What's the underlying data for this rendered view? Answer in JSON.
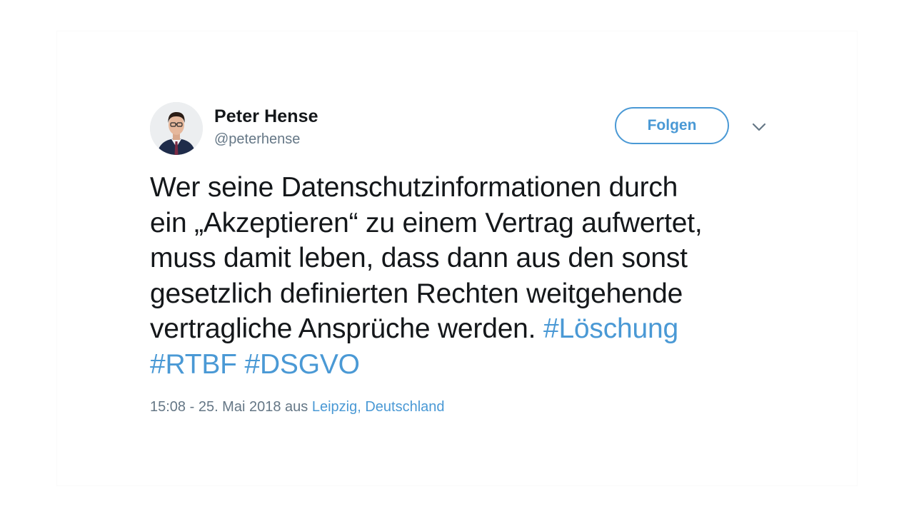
{
  "user": {
    "name": "Peter Hense",
    "handle": "@peterhense"
  },
  "follow_button": {
    "label": "Folgen"
  },
  "tweet": {
    "text_lines": [
      "Wer seine Datenschutzinformationen durch",
      "ein „Akzeptieren“ zu einem Vertrag aufwertet,",
      "muss damit leben, dass dann aus den sonst",
      "gesetzlich definierten Rechten weitgehende",
      "vertragliche Ansprüche werden."
    ],
    "hashtags": [
      "#Löschung",
      "#RTBF",
      "#DSGVO"
    ]
  },
  "meta": {
    "timestamp": "15:08 - 25. Mai 2018",
    "from": "aus",
    "location": "Leipzig, Deutschland"
  },
  "colors": {
    "link": "#4a99d5",
    "text": "#14171a",
    "secondary": "#657786"
  },
  "icons": {
    "avatar": "profile-photo",
    "caret": "chevron-down-icon"
  }
}
